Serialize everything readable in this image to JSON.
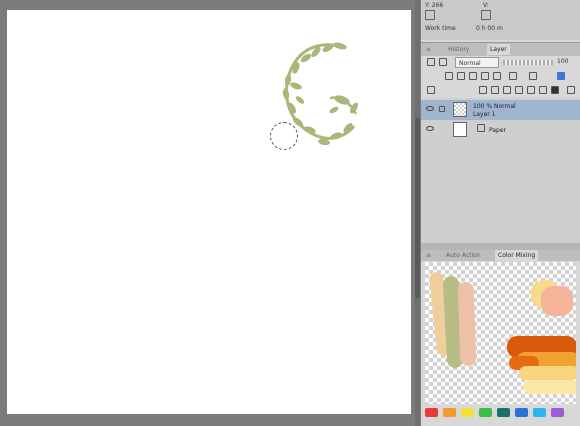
{
  "navigator": {
    "y_label": "Y: 266",
    "v_label": "V:",
    "work_time_label": "Work time",
    "work_time_value": "0 h 00 m"
  },
  "panel_tabs": {
    "history": "History",
    "layer": "Layer"
  },
  "layer_props": {
    "blend_mode": "Normal",
    "opacity": "100"
  },
  "layers": [
    {
      "line1": "100 % Normal",
      "line2": "Layer 1",
      "selected": true
    },
    {
      "line1": "Paper",
      "line2": "",
      "selected": false
    }
  ],
  "color_tabs": {
    "auto_action": "Auto Action",
    "color_mixing": "Color Mixing"
  },
  "colors": {
    "wreath": "#a8b878",
    "selection": "#9fb4cf",
    "palette": [
      "#e83a3a",
      "#f19a2e",
      "#f4df3c",
      "#3bbd4a",
      "#1d6e6e",
      "#2a72d6",
      "#2bb5e8",
      "#a05ad8"
    ]
  }
}
